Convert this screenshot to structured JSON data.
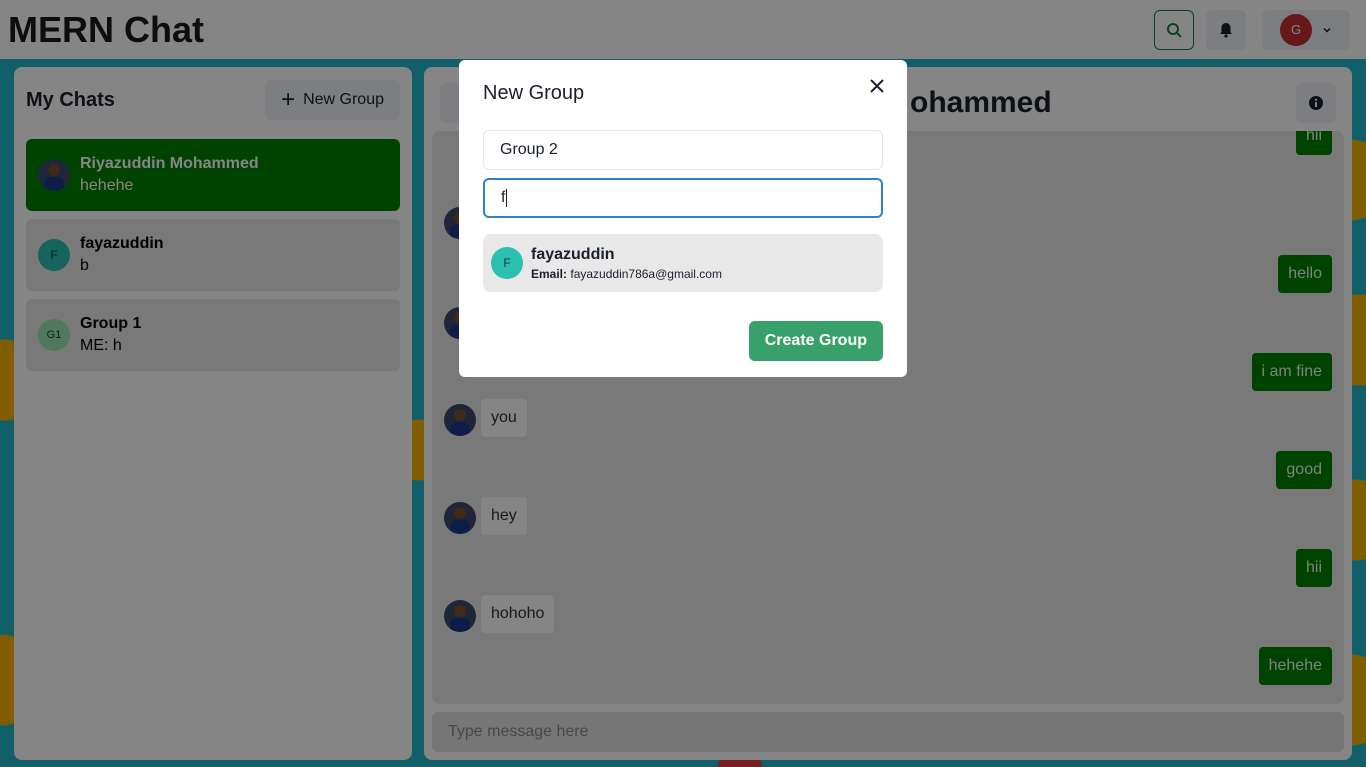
{
  "app": {
    "title": "MERN Chat"
  },
  "topbar": {
    "profile_initial": "G"
  },
  "sidebar": {
    "title": "My Chats",
    "new_group_label": "New Group",
    "chats": [
      {
        "name": "Riyazuddin Mohammed",
        "last": "hehehe",
        "avatar": "",
        "active": true
      },
      {
        "name": "fayazuddin",
        "last": "b",
        "avatar": "F",
        "active": false
      },
      {
        "name": "Group 1",
        "last": "ME: h",
        "avatar": "G1",
        "active": false
      }
    ]
  },
  "chat": {
    "title": "Riyazuddin Mohammed",
    "visible_title": "ohammed",
    "messages": [
      {
        "text": "hii",
        "dir": "out"
      },
      {
        "text": "hello",
        "dir": "out"
      },
      {
        "text": "i am fine",
        "dir": "out"
      },
      {
        "text": "you",
        "dir": "in"
      },
      {
        "text": "good",
        "dir": "out"
      },
      {
        "text": "hey",
        "dir": "in"
      },
      {
        "text": "hii",
        "dir": "out"
      },
      {
        "text": "hohoho",
        "dir": "in"
      },
      {
        "text": "hehehe",
        "dir": "out"
      }
    ],
    "composer_placeholder": "Type message here"
  },
  "modal": {
    "title": "New Group",
    "group_name_value": "Group 2",
    "search_value": "f",
    "result": {
      "avatar": "F",
      "name": "fayazuddin",
      "email_label": "Email:",
      "email": "fayazuddin786a@gmail.com"
    },
    "create_label": "Create Group"
  }
}
